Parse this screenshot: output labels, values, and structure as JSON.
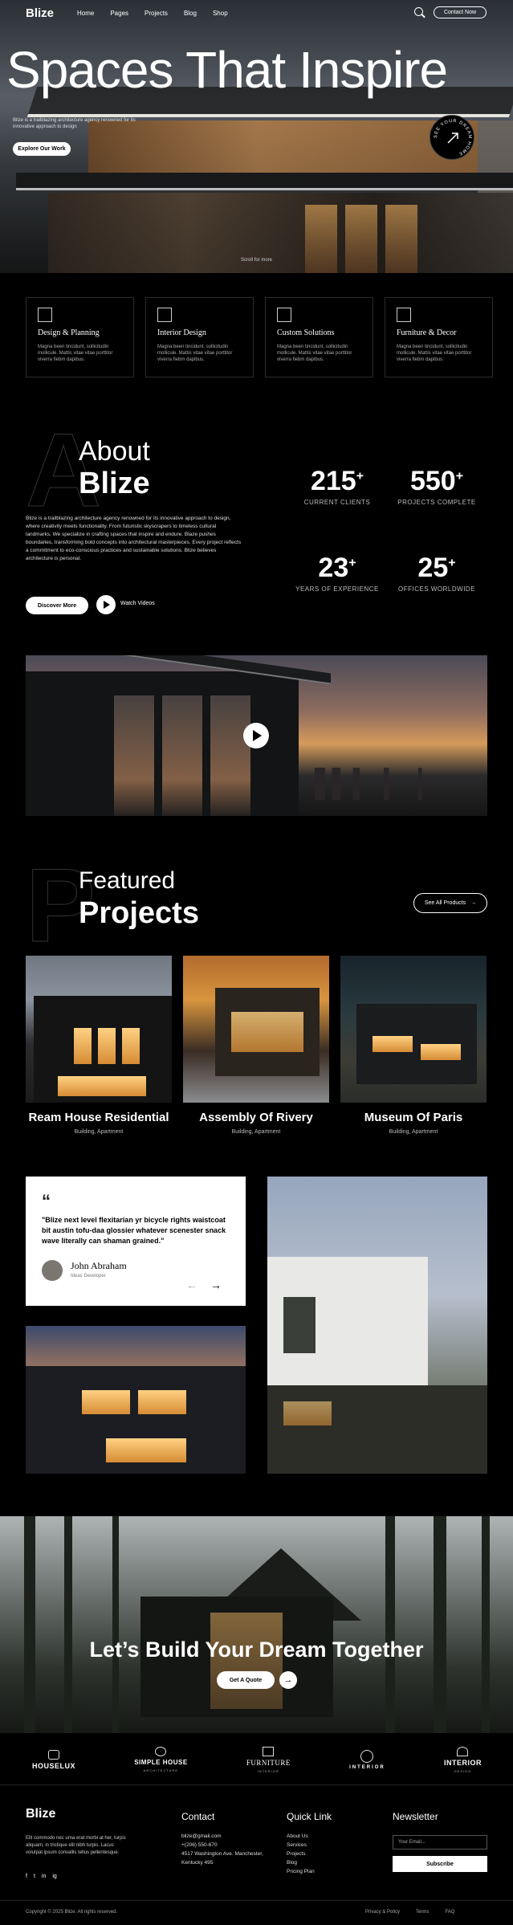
{
  "nav": {
    "logo": "Blize",
    "links": [
      "Home",
      "Pages",
      "Projects",
      "Blog",
      "Shop"
    ],
    "contact_label": "Contact Now"
  },
  "hero": {
    "title": "Spaces That Inspire",
    "description": "Blize is a trailblazing architecture agency renowned for its innovative approach to design",
    "explore_label": "Explore Our Work",
    "badge_text": "SEE YOUR DREAM HOME",
    "caption": "Scroll for more"
  },
  "services": [
    {
      "title": "Design & Planning",
      "desc": "Magna been tincidunt, sollicitudin mollicule. Mattis vitae vitae porttitor viverra fiebm dapibus."
    },
    {
      "title": "Interior Design",
      "desc": "Magna been tincidunt, sollicitudin mollicule. Mattis vitae vitae porttitor viverra fiebm dapibus."
    },
    {
      "title": "Custom Solutions",
      "desc": "Magna been tincidunt, sollicitudin mollicule. Mattis vitae vitae porttitor viverra fiebm dapibus."
    },
    {
      "title": "Furniture & Decor",
      "desc": "Magna been tincidunt, sollicitudin mollicule. Mattis vitae vitae porttitor viverra fiebm dapibus."
    }
  ],
  "about": {
    "bg_letter": "A",
    "heading_line1": "About",
    "heading_line2": "Blize",
    "paragraph": "Blize is a trailblazing architecture agency renowned for its innovative approach to design, where creativity meets functionality. From futuristic skyscrapers to timeless cultural landmarks. We specialize in crafting spaces that inspire and endure. Blaze pushes boundaries, transforming bold concepts into architectural masterpieces. Every project reflects a commitment to eco-conscious practices and sustainable solutions. Blize believes architecture is personal.",
    "discover_label": "Discover More",
    "watch_label": "Watch Videos",
    "stats": [
      {
        "number": "215",
        "suffix": "+",
        "label": "CURRENT CLIENTS"
      },
      {
        "number": "550",
        "suffix": "+",
        "label": "PROJECTS COMPLETE"
      },
      {
        "number": "23",
        "suffix": "+",
        "label": "YEARS OF EXPERIENCE"
      },
      {
        "number": "25",
        "suffix": "+",
        "label": "OFFICES WORLDWIDE"
      }
    ]
  },
  "featured": {
    "bg_letter": "P",
    "heading_line1": "Featured",
    "heading_line2": "Projects",
    "see_all_label": "See All Products",
    "projects": [
      {
        "name": "Ream House Residential",
        "category": "Building, Apartment"
      },
      {
        "name": "Assembly Of Rivery",
        "category": "Building, Apartment"
      },
      {
        "name": "Museum Of Paris",
        "category": "Building, Apartment"
      }
    ]
  },
  "testimonial": {
    "quote": "\"Blize next level flexitarian yr bicycle rights waistcoat bit austin tofu-daa glossier whatever scenester snack wave literally can shaman grained.\"",
    "name": "John Abraham",
    "role": "Ideas Developer"
  },
  "cta": {
    "title": "Let’s Build Your Dream Together",
    "quote_label": "Get A Quote"
  },
  "partners": [
    {
      "name": "HOUSELUX",
      "sub": ""
    },
    {
      "name": "SIMPLE HOUSE",
      "sub": "ARCHITECTURE"
    },
    {
      "name": "FURNITURE",
      "sub": "INTERIOR"
    },
    {
      "name": "INTERIOR",
      "sub": ""
    },
    {
      "name": "INTERIOR",
      "sub": "DESIGN"
    }
  ],
  "footer": {
    "logo": "Blize",
    "about": "Elit commodo nec urna erat morbi at her, turpis aliquam, in tristique elit nibh turpis. Lacus volutpat ipsum convallis tellus pellentesque.",
    "social": [
      "f",
      "t",
      "in",
      "ig"
    ],
    "contact_heading": "Contact",
    "contact_lines": [
      "blize@gmail.com",
      "+(206) 550-670",
      "4517 Washington Ave. Manchester, Kentucky 495"
    ],
    "quick_heading": "Quick Link",
    "quick_links": [
      "About Us",
      "Services",
      "Projects",
      "Blog",
      "Pricing Plan"
    ],
    "newsletter_heading": "Newsletter",
    "email_placeholder": "Your Email...",
    "subscribe_label": "Subscribe",
    "copyright": "Copyright © 2025 Blize. All rights reserved.",
    "bottom_links": [
      "Privacy & Policy",
      "Terms",
      "FAQ"
    ]
  }
}
